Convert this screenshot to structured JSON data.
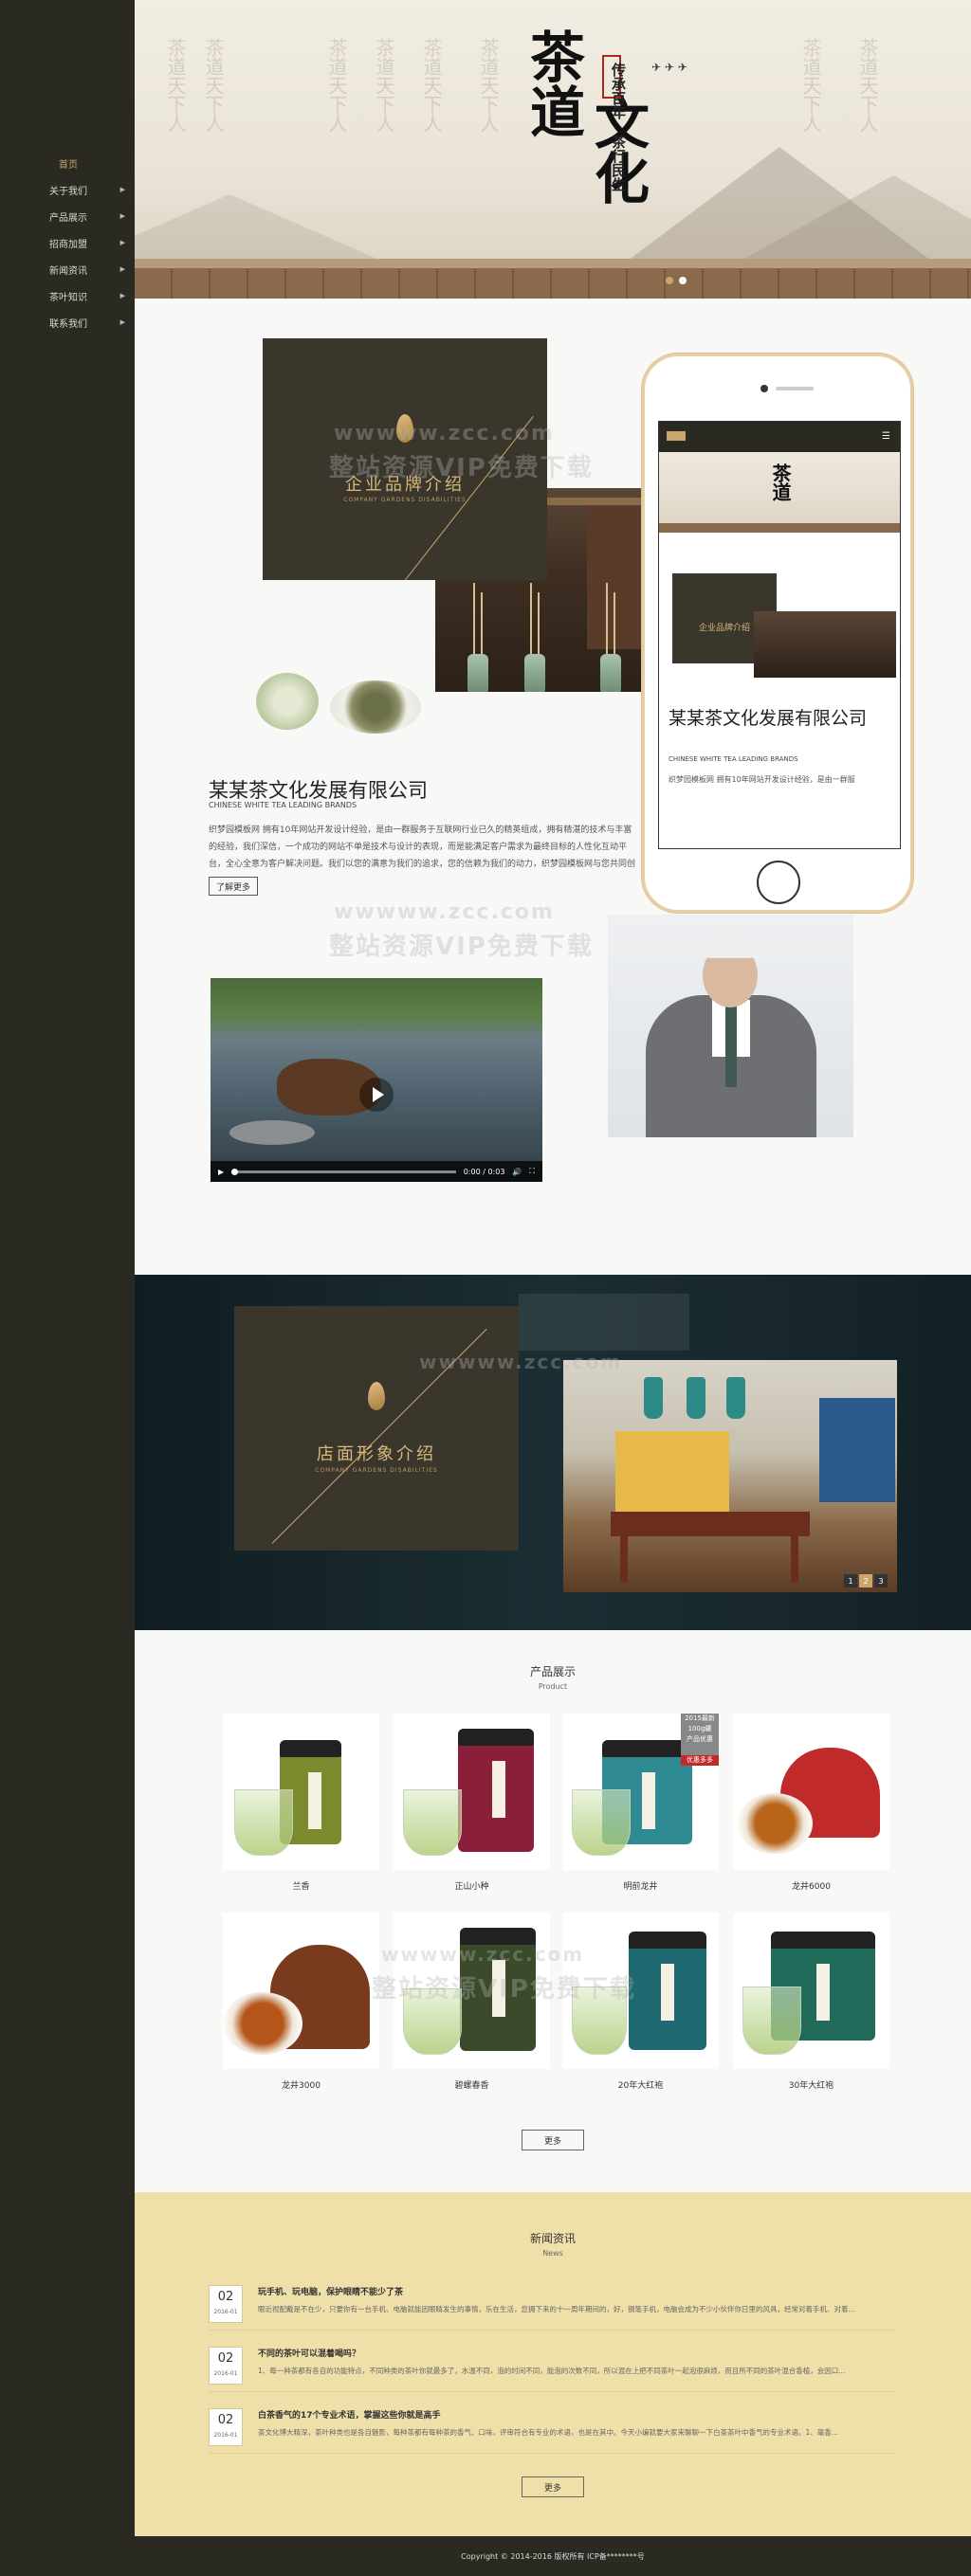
{
  "nav": {
    "items": [
      {
        "label": "首页",
        "has_arrow": false
      },
      {
        "label": "关于我们",
        "has_arrow": true
      },
      {
        "label": "产品展示",
        "has_arrow": true
      },
      {
        "label": "招商加盟",
        "has_arrow": true
      },
      {
        "label": "新闻资讯",
        "has_arrow": true
      },
      {
        "label": "茶叶知识",
        "has_arrow": true
      },
      {
        "label": "联系我们",
        "has_arrow": true
      }
    ]
  },
  "banner": {
    "title_part1": "茶道",
    "title_part2": "文化",
    "seal_text": "传承百年",
    "seal_text2": "茶行民生",
    "dots": 2,
    "active_dot": 0
  },
  "about": {
    "brand_cn": "企业品牌介绍",
    "brand_en": "COMPANY GARDENS DISABILITIES",
    "company_name": "某某茶文化发展有限公司",
    "company_en": "CHINESE WHITE TEA LEADING BRANDS",
    "description": "织梦园模板网 拥有10年网站开发设计经验，是由一群服务于互联网行业已久的精英组成，拥有精湛的技术与丰富的经验，我们深信，一个成功的网站不单是技术与设计的表现，而是能满足客户需求为最终目标的人性化互动平台，全心全意为客户解决问题。我们以您的满意为我们的追求，您的信赖为我们的动力，织梦园模板网与您共同创造辉煌！",
    "more_label": "了解更多",
    "phone_company_name": "某某茶文化发展有限公司",
    "phone_company_en": "CHINESE WHITE TEA LEADING BRANDS",
    "phone_desc": "织梦园模板网 拥有10年网站开发设计经验，是由一群服",
    "video_time": "0:00 / 0:03"
  },
  "watermark": {
    "line1": "wwwww.zcc.com",
    "line2": "整站资源VIP免费下载"
  },
  "store": {
    "title_cn": "店面形象介绍",
    "title_en": "COMPANY GARDENS DISABILITIES",
    "pages": [
      "1",
      "2",
      "3"
    ],
    "active_page": 1
  },
  "products": {
    "title": "产品展示",
    "subtitle": "Product",
    "items": [
      {
        "name": "兰香",
        "color": "#7a8a2c"
      },
      {
        "name": "正山小种",
        "color": "#8a1f3a"
      },
      {
        "name": "明前龙井",
        "color": "#2f8a94"
      },
      {
        "name": "龙井6000",
        "color": "#c02a2a"
      },
      {
        "name": "龙井3000",
        "color": "#7a3a1e"
      },
      {
        "name": "碧螺春香",
        "color": "#3a4a2a"
      },
      {
        "name": "20年大红袍",
        "color": "#1f6a70"
      },
      {
        "name": "30年大红袍",
        "color": "#1f6a58"
      }
    ],
    "tag_line1": "2015最新",
    "tag_line2": "100g罐",
    "tag_line3": "产品优惠",
    "tag_line4": "优惠多多",
    "more_label": "更多"
  },
  "news": {
    "title": "新闻资讯",
    "subtitle": "News",
    "items": [
      {
        "day": "02",
        "ym": "2016-01",
        "title": "玩手机、玩电脑，保护眼睛不能少了茶",
        "summary": "眼近视配戴是不在少，只要你有一台手机、电脑就能因眼睛发生的事情，乐在生活，您拥下来的十一周年期间的，好，钢笔手机，电脑会成为不少小伙伴你日里的风具，经常对着手机、对着..."
      },
      {
        "day": "02",
        "ym": "2016-01",
        "title": "不同的茶叶可以混着喝吗？",
        "summary": "1、每一种茶都有各自的功能特点，不同种类的茶叶你就最多了，水温不同，泡的时间不同，能泡的次数不同，所以混在上把不同茶叶一起泡很麻烦，而且所不同的茶叶混合香植，会因口..."
      },
      {
        "day": "02",
        "ym": "2016-01",
        "title": "白茶香气的17个专业术语，掌握这些你就是高手",
        "summary": "茶文化博大精深，茶叶种类也是各自魅影，每种茶都有每种茶的香气、口味，评审符合有专业的术语，也是在其中。今天小编就要大家来聊聊一下白茶茶叶中香气的专业术语。1、毫香..."
      }
    ],
    "more_label": "更多"
  },
  "footer": {
    "copyright": "Copyright © 2014-2016 版权所有 ICP备********号"
  }
}
